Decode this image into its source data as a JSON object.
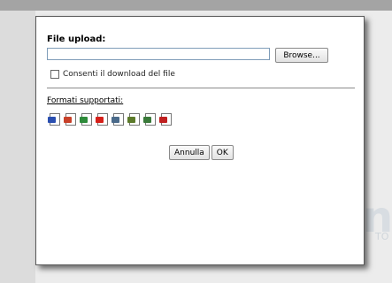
{
  "background": {
    "partial_text": "n",
    "partial_text_small": "TO"
  },
  "dialog": {
    "title": "File upload:",
    "file_input": {
      "value": "",
      "placeholder": ""
    },
    "browse_label": "Browse...",
    "checkbox_label": "Consenti il download del file",
    "checkbox_checked": false,
    "formats_link": "Formati supportati:",
    "format_icons": [
      {
        "name": "word-doc-icon",
        "color": "#2a4fb0"
      },
      {
        "name": "powerpoint-doc-icon",
        "color": "#c8412a"
      },
      {
        "name": "excel-doc-icon",
        "color": "#2e8b3a"
      },
      {
        "name": "pdf-doc-icon",
        "color": "#d6201a"
      },
      {
        "name": "png-image-icon",
        "color": "#4a6a8a"
      },
      {
        "name": "jpg-image-icon",
        "color": "#5c7a2a"
      },
      {
        "name": "gif-image-icon",
        "color": "#3a7a3a"
      },
      {
        "name": "generic-file-icon",
        "color": "#c02020"
      }
    ],
    "cancel_label": "Annulla",
    "ok_label": "OK"
  }
}
